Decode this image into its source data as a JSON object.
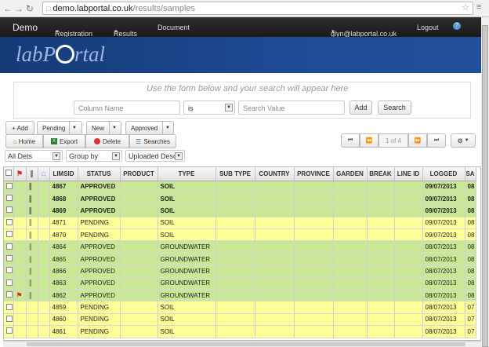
{
  "browser": {
    "url_domain": "demo.labportal.co.uk",
    "url_path": "/results/samples"
  },
  "topnav": {
    "brand": "Demo",
    "registration": "Registration",
    "results": "Results",
    "document": "Document",
    "user": "glyn@labportal.co.uk",
    "logout": "Logout"
  },
  "logo": {
    "text_pre": "labP",
    "text_post": "rtal"
  },
  "search": {
    "hint": "Use the form below and your search will appear here",
    "column_placeholder": "Column Name",
    "operator": "is",
    "value_placeholder": "Search Value",
    "add_label": "Add",
    "search_label": "Search"
  },
  "toolbar": {
    "add": "+ Add",
    "pending": "Pending",
    "new": "New",
    "approved": "Approved",
    "home": "Home",
    "export": "Export",
    "delete": "Delete",
    "searches": "Searches",
    "page": "1 of 4"
  },
  "filters": {
    "dets": "All Dets",
    "group": "Group by",
    "sort": "Uploaded Desc"
  },
  "columns": [
    "LIMSID",
    "STATUS",
    "PRODUCT",
    "TYPE",
    "SUB TYPE",
    "COUNTRY",
    "PROVINCE",
    "GARDEN",
    "BREAK",
    "LINE ID",
    "LOGGED",
    "SA"
  ],
  "rows": [
    {
      "flag": false,
      "clip": true,
      "bold": true,
      "color": "green",
      "limsid": "4867",
      "status": "APPROVED",
      "type": "SOIL",
      "logged": "09/07/2013",
      "sa": "08"
    },
    {
      "flag": false,
      "clip": true,
      "bold": true,
      "color": "green",
      "limsid": "4868",
      "status": "APPROVED",
      "type": "SOIL",
      "logged": "09/07/2013",
      "sa": "08"
    },
    {
      "flag": false,
      "clip": true,
      "bold": true,
      "color": "green",
      "limsid": "4869",
      "status": "APPROVED",
      "type": "SOIL",
      "logged": "09/07/2013",
      "sa": "08"
    },
    {
      "flag": false,
      "clip": true,
      "bold": false,
      "color": "yellow",
      "limsid": "4871",
      "status": "PENDING",
      "type": "SOIL",
      "logged": "09/07/2013",
      "sa": "08"
    },
    {
      "flag": false,
      "clip": true,
      "bold": false,
      "color": "yellow",
      "limsid": "4870",
      "status": "PENDING",
      "type": "SOIL",
      "logged": "09/07/2013",
      "sa": "08"
    },
    {
      "flag": false,
      "clip": true,
      "bold": false,
      "color": "green",
      "limsid": "4864",
      "status": "APPROVED",
      "type": "GROUNDWATER",
      "logged": "08/07/2013",
      "sa": "08"
    },
    {
      "flag": false,
      "clip": true,
      "bold": false,
      "color": "green",
      "limsid": "4865",
      "status": "APPROVED",
      "type": "GROUNDWATER",
      "logged": "08/07/2013",
      "sa": "08"
    },
    {
      "flag": false,
      "clip": true,
      "bold": false,
      "color": "green",
      "limsid": "4866",
      "status": "APPROVED",
      "type": "GROUNDWATER",
      "logged": "08/07/2013",
      "sa": "08"
    },
    {
      "flag": false,
      "clip": true,
      "bold": false,
      "color": "green",
      "limsid": "4863",
      "status": "APPROVED",
      "type": "GROUNDWATER",
      "logged": "08/07/2013",
      "sa": "08"
    },
    {
      "flag": true,
      "clip": true,
      "bold": false,
      "color": "green",
      "limsid": "4862",
      "status": "APPROVED",
      "type": "GROUNDWATER",
      "logged": "08/07/2013",
      "sa": "08"
    },
    {
      "flag": false,
      "clip": false,
      "bold": false,
      "color": "yellow",
      "limsid": "4859",
      "status": "PENDING",
      "type": "SOIL",
      "logged": "08/07/2013",
      "sa": "07"
    },
    {
      "flag": false,
      "clip": false,
      "bold": false,
      "color": "yellow",
      "limsid": "4860",
      "status": "PENDING",
      "type": "SOIL",
      "logged": "08/07/2013",
      "sa": "07"
    },
    {
      "flag": false,
      "clip": false,
      "bold": false,
      "color": "yellow",
      "limsid": "4861",
      "status": "PENDING",
      "type": "SOIL",
      "logged": "08/07/2013",
      "sa": "07"
    }
  ],
  "colors": {
    "approved_row": "#c9e896",
    "pending_row": "#ffff9a",
    "banner": "#1e4b95",
    "topbar": "#1a1a1a"
  }
}
